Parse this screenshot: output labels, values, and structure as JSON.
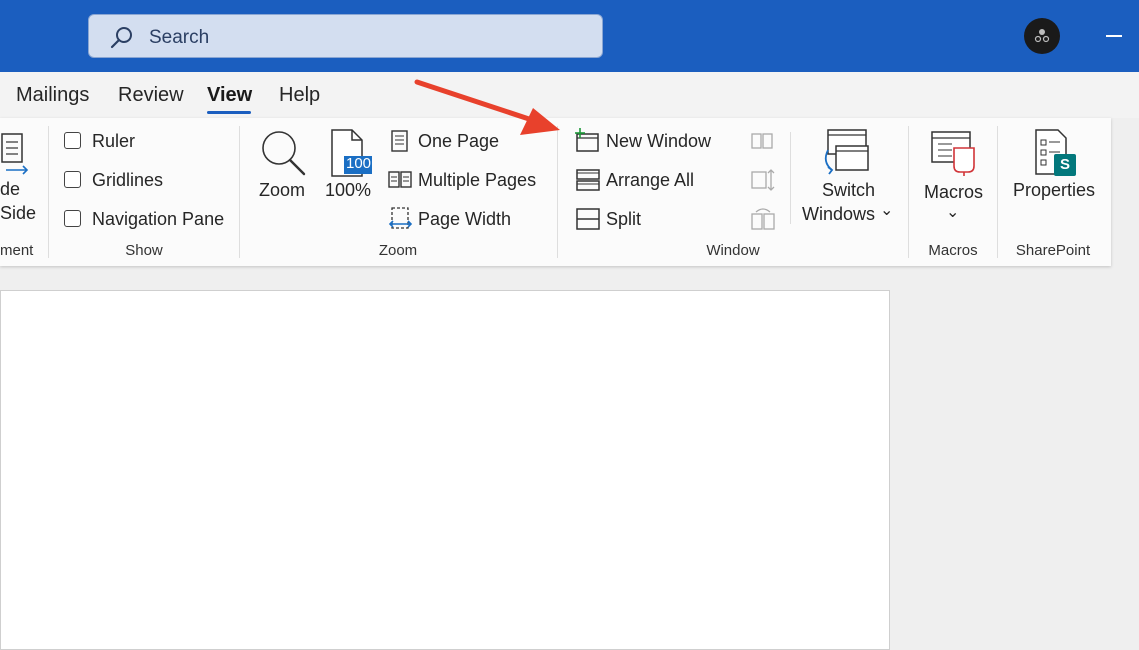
{
  "search": {
    "placeholder": "Search"
  },
  "tabs": [
    {
      "label": "Mailings"
    },
    {
      "label": "Review"
    },
    {
      "label": "View",
      "active": true
    },
    {
      "label": "Help"
    }
  ],
  "ribbon": {
    "cutoff_group": {
      "line1": "de",
      "line2": "Side",
      "label": "ment"
    },
    "show": {
      "label": "Show",
      "items": [
        {
          "label": "Ruler",
          "checked": false
        },
        {
          "label": "Gridlines",
          "checked": false
        },
        {
          "label": "Navigation Pane",
          "checked": false
        }
      ]
    },
    "zoom": {
      "label": "Zoom",
      "zoom_button": "Zoom",
      "percent_button": "100%",
      "percent_badge": "100",
      "one_page": "One Page",
      "multiple_pages": "Multiple Pages",
      "page_width": "Page Width"
    },
    "window": {
      "label": "Window",
      "new_window": "New Window",
      "arrange_all": "Arrange All",
      "split": "Split",
      "switch_line1": "Switch",
      "switch_line2": "Windows",
      "chevron": "⌄"
    },
    "macros": {
      "label": "Macros",
      "button": "Macros",
      "chevron": "⌄"
    },
    "sharepoint": {
      "label": "SharePoint",
      "button": "Properties",
      "badge": "S"
    }
  },
  "colors": {
    "titlebar": "#1b5ebf",
    "annotation_arrow": "#e8412c",
    "accent": "#1b5ebf"
  }
}
